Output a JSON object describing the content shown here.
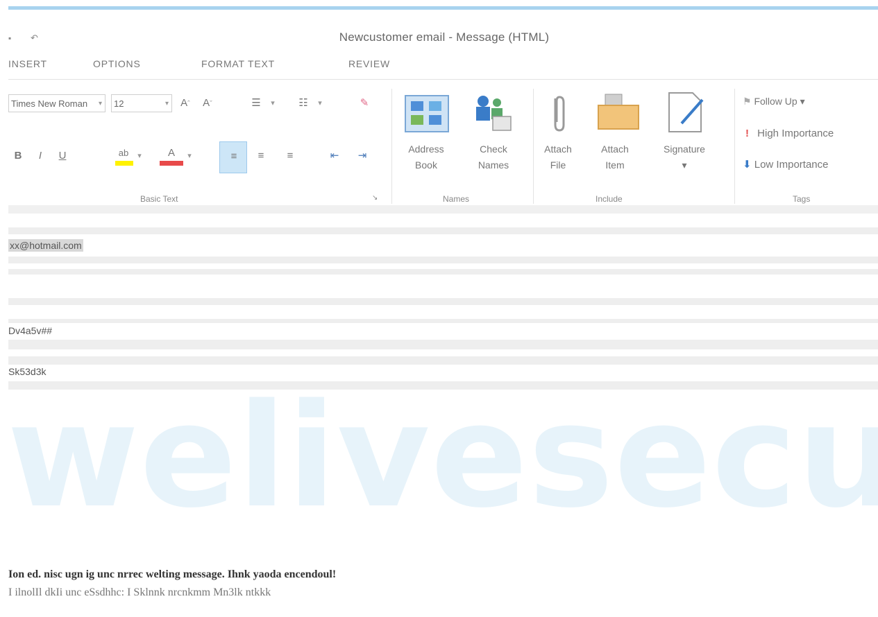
{
  "window": {
    "title": "Newcustomer email - Message (HTML)",
    "qat_icon": "save-icon",
    "qat_icon2": "undo-icon"
  },
  "tabs": [
    {
      "label": "INSERT"
    },
    {
      "label": "OPTIONS"
    },
    {
      "label": "FORMAT TEXT"
    },
    {
      "label": "REVIEW"
    }
  ],
  "ribbon": {
    "basic_text": {
      "label": "Basic Text",
      "font_name": "Times New Roman",
      "font_size": "12",
      "bold": "B",
      "italic": "I",
      "underline": "U"
    },
    "names": {
      "label": "Names",
      "address_book": {
        "line1": "Address",
        "line2": "Book"
      },
      "check_names": {
        "line1": "Check",
        "line2": "Names"
      }
    },
    "include": {
      "label": "Include",
      "attach_file": {
        "line1": "Attach",
        "line2": "File"
      },
      "attach_item": {
        "line1": "Attach",
        "line2": "Item"
      },
      "signature": {
        "line1": "Signature",
        "line2": "▾"
      }
    },
    "tags": {
      "label": "Tags",
      "follow_up": "Follow Up ▾",
      "high_importance": "High Importance",
      "low_importance": "Low Importance"
    }
  },
  "fields": {
    "to": "xx@hotmail.com",
    "cc": "",
    "bcc": "",
    "subject": "Dv4a5v##",
    "attached": "Sk53d3k"
  },
  "watermark": "welivesecurity",
  "body": {
    "line1": "Ion ed. nisc ugn ig unc nrrec welting message. Ihnk yaoda encendoul!",
    "line2": "I ilnolIl dkIi unc eSsdhhc: I Sklnnk nrcnkmm Mn3lk ntkkk"
  },
  "colors": {
    "accent": "#a8d3ef",
    "highlight_yellow": "#fff200",
    "font_red": "#e84a4a",
    "watermark": "#e7f3fa"
  }
}
